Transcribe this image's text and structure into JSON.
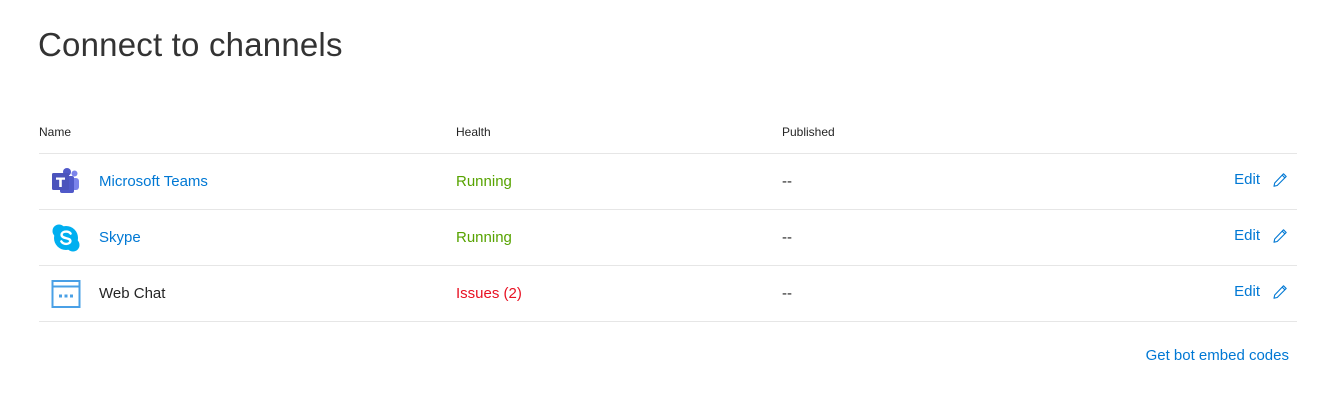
{
  "page": {
    "title": "Connect to channels"
  },
  "table": {
    "headers": {
      "name": "Name",
      "health": "Health",
      "published": "Published"
    },
    "rows": [
      {
        "name": "Microsoft Teams",
        "icon": "microsoft-teams-icon",
        "health": "Running",
        "health_status": "ok",
        "published": "--",
        "action": "Edit"
      },
      {
        "name": "Skype",
        "icon": "skype-icon",
        "health": "Running",
        "health_status": "ok",
        "published": "--",
        "action": "Edit"
      },
      {
        "name": "Web Chat",
        "icon": "web-chat-icon",
        "health": "Issues (2)",
        "health_status": "error",
        "published": "--",
        "action": "Edit"
      }
    ]
  },
  "footer": {
    "embed_link": "Get bot embed codes"
  },
  "colors": {
    "link": "#0078d4",
    "running": "#57a300",
    "issues": "#e81123",
    "teams_brand": "#5059c9",
    "skype_brand": "#00aff0",
    "webchat_brand": "#4aa0e6",
    "divider": "#e6e6e6"
  }
}
